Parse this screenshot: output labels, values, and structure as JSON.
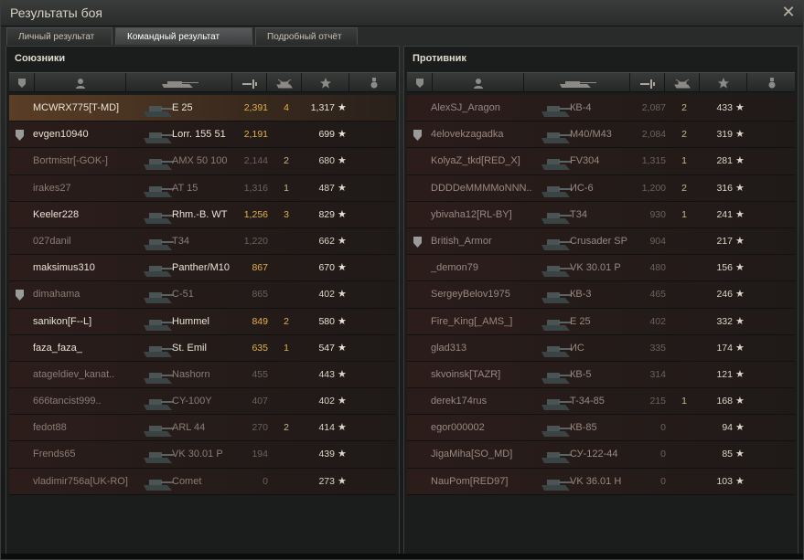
{
  "window": {
    "title": "Результаты боя"
  },
  "tabs": [
    {
      "label": "Личный результат",
      "active": false
    },
    {
      "label": "Командный результат",
      "active": true
    },
    {
      "label": "Подробный отчёт",
      "active": false
    }
  ],
  "colors": {
    "accent_damage": "#e2b14a",
    "self_row": "#5a3e26",
    "dead_text": "#8a7d74"
  },
  "allies": {
    "title": "Союзники",
    "rows": [
      {
        "name": "MCWRX775[T-MD]",
        "tank": "E 25",
        "damage": "2,391",
        "kills": "4",
        "xp": "1,317",
        "badge": "",
        "state": "alive",
        "self": true
      },
      {
        "name": "evgen10940",
        "tank": "Lorr. 155 51",
        "damage": "2,191",
        "kills": "",
        "xp": "699",
        "badge": "shield",
        "state": "alive"
      },
      {
        "name": "Bortmistr[-GOK-]",
        "tank": "AMX 50 100",
        "damage": "2,144",
        "kills": "2",
        "xp": "680",
        "badge": "",
        "state": "dead"
      },
      {
        "name": "irakes27",
        "tank": "AT 15",
        "damage": "1,316",
        "kills": "1",
        "xp": "487",
        "badge": "",
        "state": "dead"
      },
      {
        "name": "Keeler228",
        "tank": "Rhm.-B. WT",
        "damage": "1,256",
        "kills": "3",
        "xp": "829",
        "badge": "",
        "state": "alive"
      },
      {
        "name": "027danil",
        "tank": "T34",
        "damage": "1,220",
        "kills": "",
        "xp": "662",
        "badge": "",
        "state": "dead"
      },
      {
        "name": "maksimus310",
        "tank": "Panther/M10",
        "damage": "867",
        "kills": "",
        "xp": "670",
        "badge": "",
        "state": "alive"
      },
      {
        "name": "dimahama",
        "tank": "C-51",
        "damage": "865",
        "kills": "",
        "xp": "402",
        "badge": "shield",
        "state": "dead"
      },
      {
        "name": "sanikon[F--L]",
        "tank": "Hummel",
        "damage": "849",
        "kills": "2",
        "xp": "580",
        "badge": "",
        "state": "alive"
      },
      {
        "name": "faza_faza_",
        "tank": "St. Emil",
        "damage": "635",
        "kills": "1",
        "xp": "547",
        "badge": "",
        "state": "alive"
      },
      {
        "name": "atageldiev_kanat..",
        "tank": "Nashorn",
        "damage": "455",
        "kills": "",
        "xp": "443",
        "badge": "",
        "state": "dead"
      },
      {
        "name": "666tancist999..",
        "tank": "CY-100Y",
        "damage": "407",
        "kills": "",
        "xp": "402",
        "badge": "",
        "state": "dead"
      },
      {
        "name": "fedot88",
        "tank": "ARL 44",
        "damage": "270",
        "kills": "2",
        "xp": "414",
        "badge": "",
        "state": "dead"
      },
      {
        "name": "Frends65",
        "tank": "VK 30.01 P",
        "damage": "194",
        "kills": "",
        "xp": "439",
        "badge": "",
        "state": "dead"
      },
      {
        "name": "vladimir756a[UK-RO]",
        "tank": "Comet",
        "damage": "0",
        "kills": "",
        "xp": "273",
        "badge": "",
        "state": "dead"
      }
    ]
  },
  "enemies": {
    "title": "Противник",
    "rows": [
      {
        "name": "AlexSJ_Aragon",
        "tank": "КВ-4",
        "damage": "2,087",
        "kills": "2",
        "xp": "433",
        "badge": "",
        "state": "dead"
      },
      {
        "name": "4elovekzagadka",
        "tank": "M40/M43",
        "damage": "2,084",
        "kills": "2",
        "xp": "319",
        "badge": "shield",
        "state": "dead"
      },
      {
        "name": "KolyaZ_tkd[RED_X]",
        "tank": "FV304",
        "damage": "1,315",
        "kills": "1",
        "xp": "281",
        "badge": "",
        "state": "dead"
      },
      {
        "name": "DDDDeMMMMoNNN..",
        "tank": "ИС-6",
        "damage": "1,200",
        "kills": "2",
        "xp": "316",
        "badge": "",
        "state": "dead"
      },
      {
        "name": "ybivaha12[RL-BY]",
        "tank": "T34",
        "damage": "930",
        "kills": "1",
        "xp": "241",
        "badge": "",
        "state": "dead"
      },
      {
        "name": "British_Armor",
        "tank": "Crusader SP",
        "damage": "904",
        "kills": "",
        "xp": "217",
        "badge": "shield",
        "state": "dead"
      },
      {
        "name": "_demon79",
        "tank": "VK 30.01 P",
        "damage": "480",
        "kills": "",
        "xp": "156",
        "badge": "",
        "state": "dead"
      },
      {
        "name": "SergeyBelov1975",
        "tank": "КВ-3",
        "damage": "465",
        "kills": "",
        "xp": "246",
        "badge": "",
        "state": "dead"
      },
      {
        "name": "Fire_King[_AMS_]",
        "tank": "E 25",
        "damage": "402",
        "kills": "",
        "xp": "332",
        "badge": "",
        "state": "dead"
      },
      {
        "name": "glad313",
        "tank": "ИС",
        "damage": "335",
        "kills": "",
        "xp": "174",
        "badge": "",
        "state": "dead"
      },
      {
        "name": "skvoinsk[TAZR]",
        "tank": "КВ-5",
        "damage": "314",
        "kills": "",
        "xp": "121",
        "badge": "",
        "state": "dead"
      },
      {
        "name": "derek174rus",
        "tank": "T-34-85",
        "damage": "215",
        "kills": "1",
        "xp": "168",
        "badge": "",
        "state": "dead"
      },
      {
        "name": "egor000002",
        "tank": "КВ-85",
        "damage": "0",
        "kills": "",
        "xp": "94",
        "badge": "",
        "state": "dead"
      },
      {
        "name": "JigaMiha[SO_MD]",
        "tank": "СУ-122-44",
        "damage": "0",
        "kills": "",
        "xp": "85",
        "badge": "",
        "state": "dead"
      },
      {
        "name": "NauPom[RED97]",
        "tank": "VK 36.01 H",
        "damage": "0",
        "kills": "",
        "xp": "103",
        "badge": "",
        "state": "dead"
      }
    ]
  },
  "star_glyph": "★",
  "icons": {
    "close": "close-icon",
    "columns": [
      "clan-badge-icon",
      "player-icon",
      "tank-icon",
      "damage-icon",
      "kills-icon",
      "xp-star-icon",
      "medal-icon"
    ]
  }
}
